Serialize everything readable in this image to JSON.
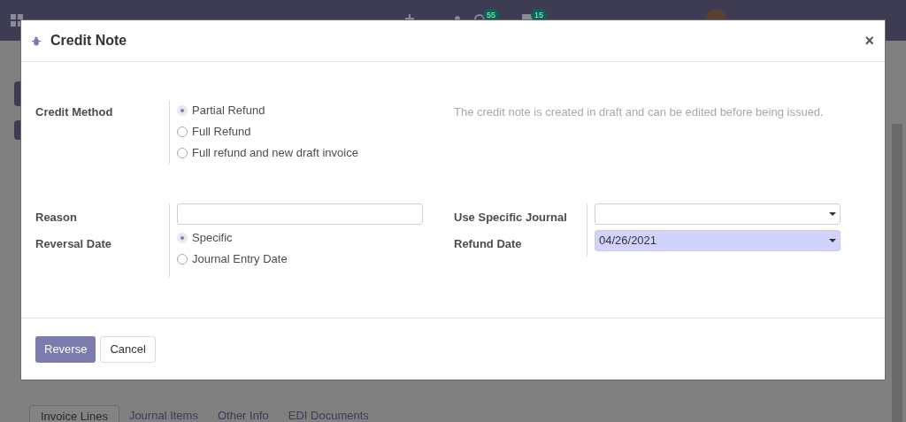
{
  "navbar": {
    "activity_count": "55",
    "message_count": "15"
  },
  "page": {
    "tabs": [
      {
        "label": "Invoice Lines",
        "selected": true
      },
      {
        "label": "Journal Items",
        "selected": false
      },
      {
        "label": "Other Info",
        "selected": false
      },
      {
        "label": "EDI Documents",
        "selected": false
      }
    ]
  },
  "dialog": {
    "title": "Credit Note",
    "close": "×",
    "credit_method": {
      "label": "Credit Method",
      "options": [
        {
          "label": "Partial Refund",
          "selected": true
        },
        {
          "label": "Full Refund",
          "selected": false
        },
        {
          "label": "Full refund and new draft invoice",
          "selected": false
        }
      ],
      "help": "The credit note is created in draft and can be edited before being issued."
    },
    "reason": {
      "label": "Reason"
    },
    "reversal_date": {
      "label": "Reversal Date",
      "options": [
        {
          "label": "Specific",
          "selected": true
        },
        {
          "label": "Journal Entry Date",
          "selected": false
        }
      ]
    },
    "journal": {
      "label": "Use Specific Journal"
    },
    "refund_date": {
      "label": "Refund Date",
      "value": "04/26/2021"
    },
    "buttons": [
      {
        "label": "Reverse",
        "kind": "primary"
      },
      {
        "label": "Cancel",
        "kind": "secondary"
      }
    ]
  }
}
